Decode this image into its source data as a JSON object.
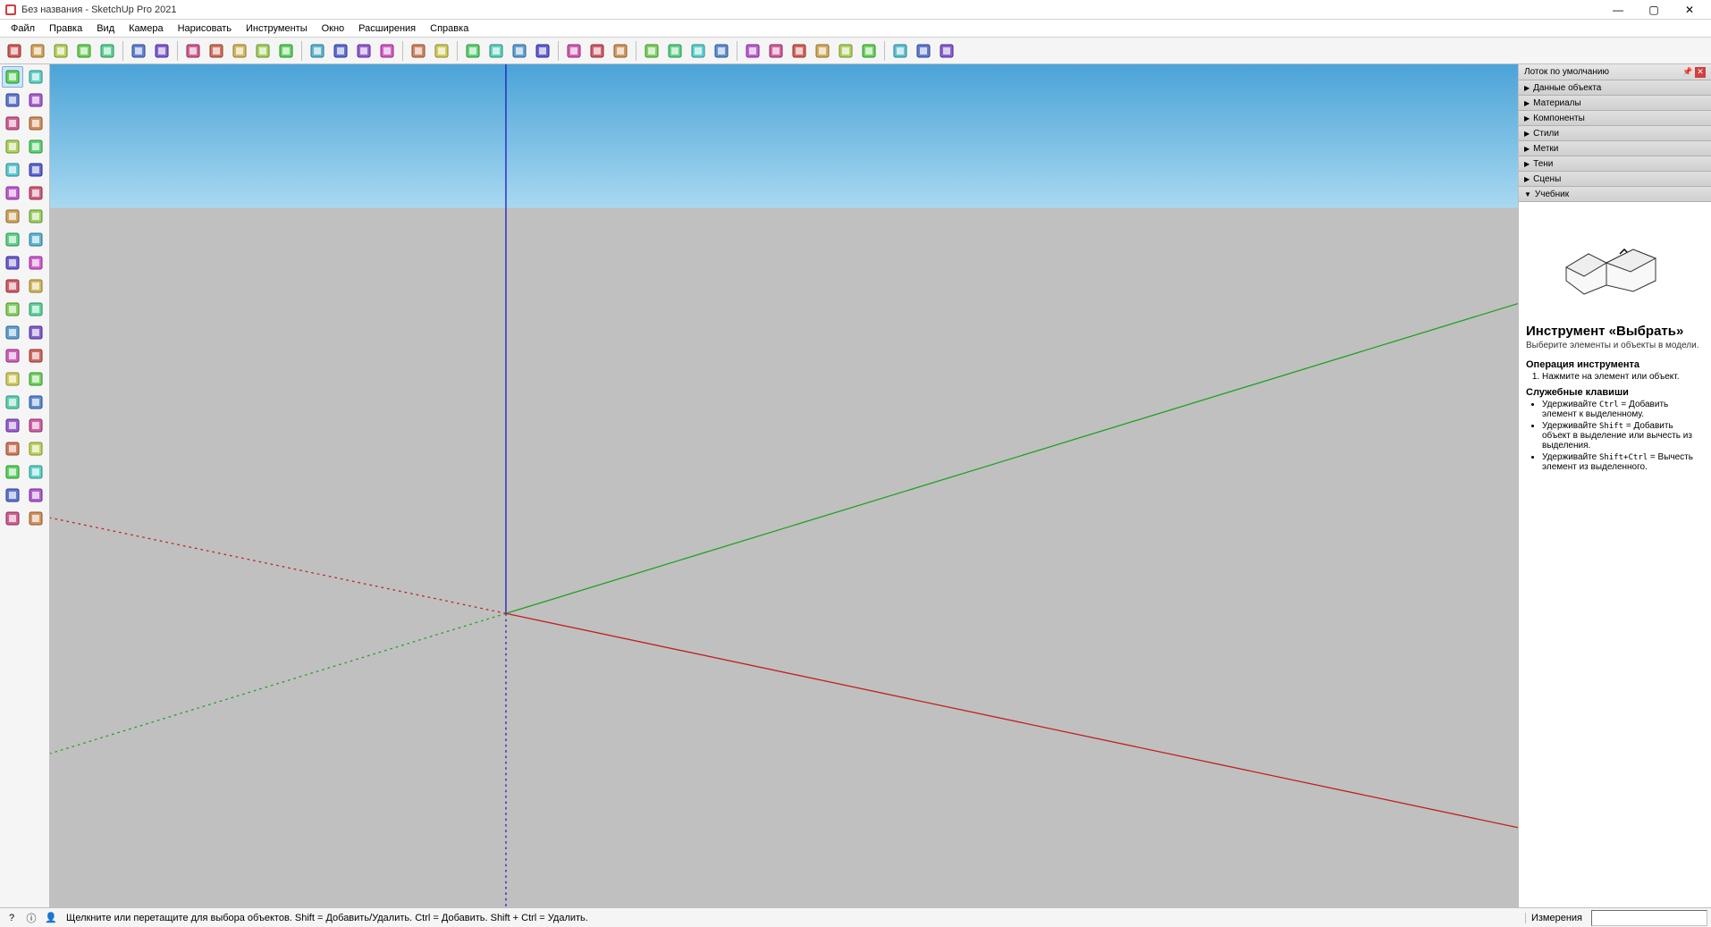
{
  "window": {
    "title": "Без названия - SketchUp Pro 2021",
    "minimize": "—",
    "maximize": "▢",
    "close": "✕"
  },
  "menu": [
    "Файл",
    "Правка",
    "Вид",
    "Камера",
    "Нарисовать",
    "Инструменты",
    "Окно",
    "Расширения",
    "Справка"
  ],
  "toolbar_top": [
    {
      "name": "open-icon"
    },
    {
      "name": "save-icon"
    },
    {
      "name": "upload-icon"
    },
    {
      "name": "3dwarehouse-icon"
    },
    {
      "name": "refresh-icon"
    },
    {
      "sep": true
    },
    {
      "name": "layer-icon"
    },
    {
      "name": "grid-icon"
    },
    {
      "sep": true
    },
    {
      "name": "sandbox1-icon"
    },
    {
      "name": "sandbox2-icon"
    },
    {
      "name": "sandbox3-icon"
    },
    {
      "name": "sandbox4-icon"
    },
    {
      "name": "sandbox5-icon"
    },
    {
      "sep": true
    },
    {
      "name": "section1-icon"
    },
    {
      "name": "section2-icon"
    },
    {
      "name": "section3-icon"
    },
    {
      "name": "section4-icon"
    },
    {
      "sep": true
    },
    {
      "name": "geo1-icon"
    },
    {
      "name": "geo2-icon"
    },
    {
      "sep": true
    },
    {
      "name": "solid1-icon"
    },
    {
      "name": "solid2-icon"
    },
    {
      "name": "solid3-icon"
    },
    {
      "name": "solid4-icon"
    },
    {
      "sep": true
    },
    {
      "name": "style1-icon"
    },
    {
      "name": "style2-icon"
    },
    {
      "name": "style3-icon"
    },
    {
      "sep": true
    },
    {
      "name": "view1-icon"
    },
    {
      "name": "view2-icon"
    },
    {
      "name": "view3-icon"
    },
    {
      "name": "view4-icon"
    },
    {
      "sep": true
    },
    {
      "name": "warehouse1-icon"
    },
    {
      "name": "warehouse2-icon"
    },
    {
      "name": "warehouse3-icon"
    },
    {
      "name": "warehouse4-icon"
    },
    {
      "name": "warehouse5-icon"
    },
    {
      "name": "warehouse6-icon"
    },
    {
      "sep": true
    },
    {
      "name": "ext1-icon"
    },
    {
      "name": "ext2-icon"
    },
    {
      "name": "ext3-icon"
    }
  ],
  "left_tools": [
    {
      "name": "select-tool",
      "active": true
    },
    {
      "name": "orbit-tool2"
    },
    {
      "name": "line-tool"
    },
    {
      "name": "eraser-tool"
    },
    {
      "name": "pencil-tool"
    },
    {
      "name": "freehand-tool"
    },
    {
      "name": "rectangle-tool"
    },
    {
      "name": "rotated-rect-tool"
    },
    {
      "name": "circle-tool"
    },
    {
      "name": "polygon-tool"
    },
    {
      "name": "arc-tool"
    },
    {
      "name": "arc2-tool"
    },
    {
      "name": "arc3-tool"
    },
    {
      "name": "pie-tool"
    },
    {
      "name": "move-tool"
    },
    {
      "name": "pushpull-tool"
    },
    {
      "name": "rotate-tool"
    },
    {
      "name": "followme-tool"
    },
    {
      "name": "scale-tool"
    },
    {
      "name": "offset-tool"
    },
    {
      "name": "tape-tool"
    },
    {
      "name": "dimension-tool"
    },
    {
      "name": "protractor-tool"
    },
    {
      "name": "text-tool"
    },
    {
      "name": "axes-tool"
    },
    {
      "name": "3dtext-tool"
    },
    {
      "name": "orbit-tool"
    },
    {
      "name": "pan-tool"
    },
    {
      "name": "zoom-tool"
    },
    {
      "name": "zoomwindow-tool"
    },
    {
      "name": "zoomextents-tool"
    },
    {
      "name": "previous-tool"
    },
    {
      "name": "position-camera-tool"
    },
    {
      "name": "lookaround-tool"
    },
    {
      "name": "walk-tool"
    },
    {
      "name": "section-tool"
    },
    {
      "name": "extra1-tool"
    },
    {
      "name": "extra2-tool"
    },
    {
      "name": "extra3-tool"
    },
    {
      "name": "extra4-tool"
    }
  ],
  "tray": {
    "title": "Лоток по умолчанию",
    "panels": [
      {
        "label": "Данные объекта",
        "expanded": false
      },
      {
        "label": "Материалы",
        "expanded": false
      },
      {
        "label": "Компоненты",
        "expanded": false
      },
      {
        "label": "Стили",
        "expanded": false
      },
      {
        "label": "Метки",
        "expanded": false
      },
      {
        "label": "Тени",
        "expanded": false
      },
      {
        "label": "Сцены",
        "expanded": false
      },
      {
        "label": "Учебник",
        "expanded": true
      }
    ]
  },
  "instructor": {
    "title": "Инструмент «Выбрать»",
    "description": "Выберите элементы и объекты в модели.",
    "operation_heading": "Операция инструмента",
    "operation_step": "Нажмите на элемент или объект.",
    "keys_heading": "Служебные клавиши",
    "key1_pre": "Удерживайте ",
    "key1_code": "Ctrl",
    "key1_post": " = Добавить элемент к выделенному.",
    "key2_pre": "Удерживайте ",
    "key2_code": "Shift",
    "key2_post": " = Добавить объект в выделение или вычесть из выделения.",
    "key3_pre": "Удерживайте ",
    "key3_code": "Shift+Ctrl",
    "key3_post": " = Вычесть элемент из выделенного."
  },
  "status": {
    "message": "Щелкните или перетащите для выбора объектов. Shift = Добавить/Удалить. Ctrl = Добавить. Shift + Ctrl = Удалить.",
    "measure_label": "Измерения"
  }
}
